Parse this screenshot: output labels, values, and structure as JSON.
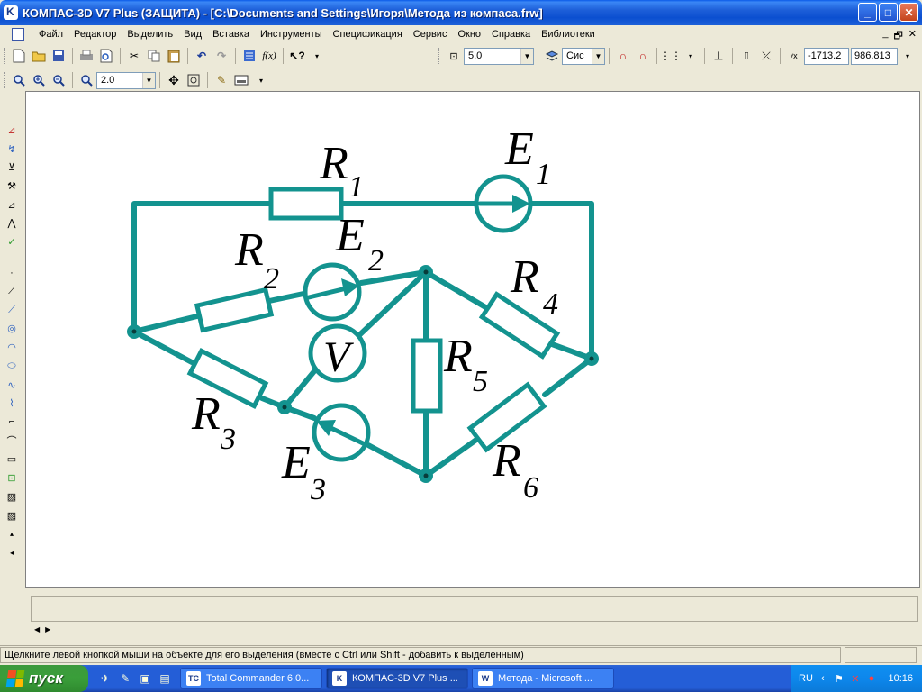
{
  "window": {
    "title": "КОМПАС-3D V7 Plus (ЗАЩИТА) - [C:\\Documents and Settings\\Игоря\\Метода из компаса.frw]",
    "buttons": {
      "minimize": "_",
      "maximize": "□",
      "close": "✕"
    }
  },
  "menu": {
    "items": [
      "Файл",
      "Редактор",
      "Выделить",
      "Вид",
      "Вставка",
      "Инструменты",
      "Спецификация",
      "Сервис",
      "Окно",
      "Справка",
      "Библиотеки"
    ],
    "mdi": [
      "_",
      "🗗",
      "✕"
    ]
  },
  "toolbar1": {
    "step_value": "5.0",
    "layer_value": "Сис",
    "coord_x": "-1713.2",
    "coord_y": "986.813"
  },
  "toolbar2": {
    "zoom_value": "2.0"
  },
  "circuit": {
    "color": "#13938f",
    "labels": {
      "R1": "R",
      "R1_sub": "1",
      "R2": "R",
      "R2_sub": "2",
      "R3": "R",
      "R3_sub": "3",
      "R4": "R",
      "R4_sub": "4",
      "R5": "R",
      "R5_sub": "5",
      "R6": "R",
      "R6_sub": "6",
      "E1": "E",
      "E1_sub": "1",
      "E2": "E",
      "E2_sub": "2",
      "E3": "E",
      "E3_sub": "3",
      "V": "V"
    }
  },
  "status": {
    "text": "Щелкните левой кнопкой мыши на объекте для его выделения (вместе с Ctrl или Shift - добавить к выделенным)"
  },
  "taskbar": {
    "start_label": "пуск",
    "tasks": [
      {
        "label": "Total Commander 6.0...",
        "icon": "TC"
      },
      {
        "label": "КОМПАС-3D V7 Plus ...",
        "icon": "K"
      },
      {
        "label": "Метода - Microsoft ...",
        "icon": "W"
      }
    ],
    "lang": "RU",
    "clock": "10:16"
  }
}
